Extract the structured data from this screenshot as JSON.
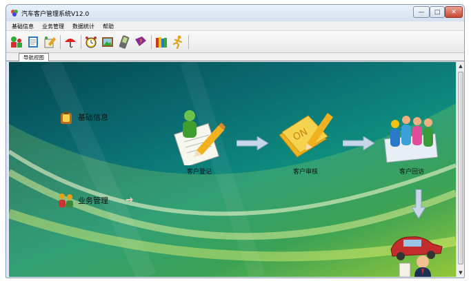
{
  "window": {
    "title": "汽车客户管理系统V12.0"
  },
  "menu": [
    {
      "label": "基础信息"
    },
    {
      "label": "业务管理"
    },
    {
      "label": "数据统计"
    },
    {
      "label": "帮助"
    }
  ],
  "toolbar": {
    "buttons": [
      {
        "icon": "people-icon"
      },
      {
        "icon": "notebook-icon"
      },
      {
        "icon": "edit-icon"
      },
      {
        "icon": "umbrella-icon"
      },
      {
        "icon": "alarm-clock-icon"
      },
      {
        "icon": "picture-icon"
      },
      {
        "icon": "handheld-icon"
      },
      {
        "icon": "help-book-icon"
      },
      {
        "icon": "books-icon"
      },
      {
        "icon": "running-man-icon"
      }
    ]
  },
  "tabs": [
    {
      "label": "导航视图"
    }
  ],
  "nav": {
    "basic_info": "基础信息",
    "business": "业务管理",
    "steps": [
      {
        "label": "客户登记"
      },
      {
        "label": "客户审核"
      },
      {
        "label": "客户回访"
      }
    ]
  },
  "colors": {
    "accent": "#0a6a70",
    "title_bar": "#d4e1f0",
    "background_green": "#8fc12d"
  }
}
